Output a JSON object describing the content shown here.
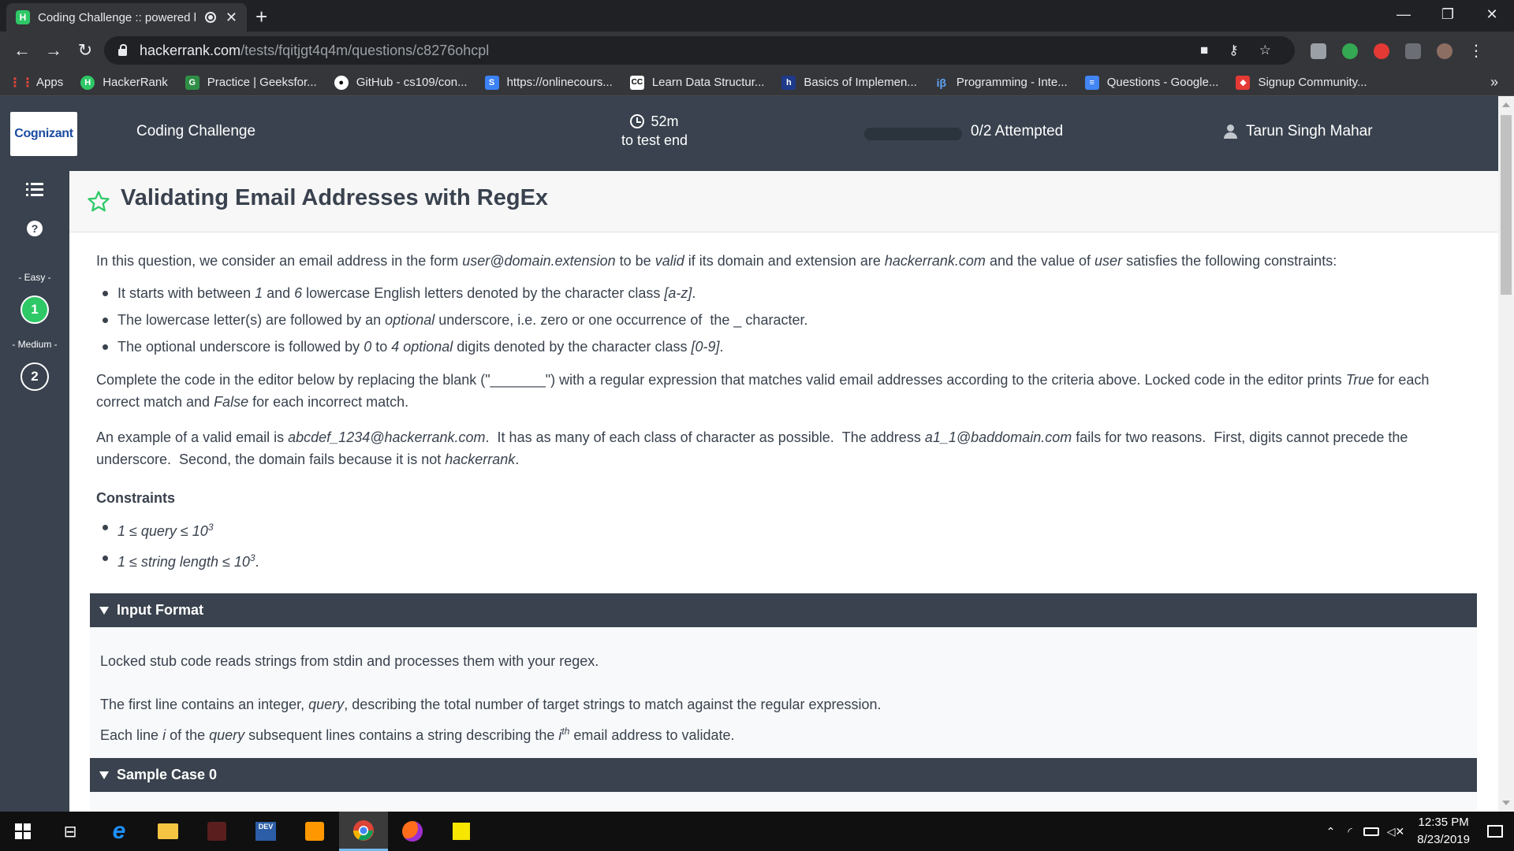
{
  "browser": {
    "tab_title": "Coding Challenge :: powered by HackerRank",
    "url_host": "hackerrank.com",
    "url_path": "/tests/fqitjgt4q4m/questions/c8276ohcpl",
    "bookmarks": [
      {
        "label": "Apps",
        "color": "#e8453c"
      },
      {
        "label": "HackerRank",
        "color": "#2ec866"
      },
      {
        "label": "Practice | Geeksfor...",
        "color": "#2f8d46"
      },
      {
        "label": "GitHub - cs109/con...",
        "color": "#ffffff"
      },
      {
        "label": "https://onlinecours...",
        "color": "#3b82f6"
      },
      {
        "label": "Learn Data Structur...",
        "color": "#ffffff"
      },
      {
        "label": "Basics of Implemen...",
        "color": "#1f3a8a"
      },
      {
        "label": "Programming - Inte...",
        "color": "#60a5fa"
      },
      {
        "label": "Questions - Google...",
        "color": "#4285f4"
      },
      {
        "label": "Signup Community...",
        "color": "#e53935"
      }
    ],
    "bookmarks_more": "»"
  },
  "header": {
    "logo": "Cognizant",
    "title": "Coding Challenge",
    "timer_value": "52m",
    "timer_caption": "to test end",
    "attempted": "0/2 Attempted",
    "user": "Tarun Singh Mahar"
  },
  "sidebar": {
    "help": "?",
    "levels": [
      {
        "label": "- Easy -",
        "question": "1"
      },
      {
        "label": "- Medium -",
        "question": "2"
      }
    ]
  },
  "question": {
    "title": "Validating Email Addresses with RegEx",
    "constraints_heading": "Constraints",
    "constraint_1": "1 ≤ query ≤ 10",
    "constraint_2": "1 ≤ string length ≤ 10",
    "exponent": "3"
  },
  "input_format": {
    "heading": "Input Format",
    "line1": "Locked stub code reads strings from stdin and processes them with your regex.",
    "line2": "The first line contains an integer, query, describing the total number of target strings to match against the regular expression.",
    "line3": "Each line i of the query subsequent lines contains a string describing the ith email address to validate."
  },
  "sample_case": {
    "heading": "Sample Case 0"
  },
  "taskbar": {
    "time": "12:35 PM",
    "date": "8/23/2019"
  },
  "colors": {
    "header_bg": "#39424e",
    "accent_green": "#2ec866",
    "content_text": "#39424e"
  }
}
